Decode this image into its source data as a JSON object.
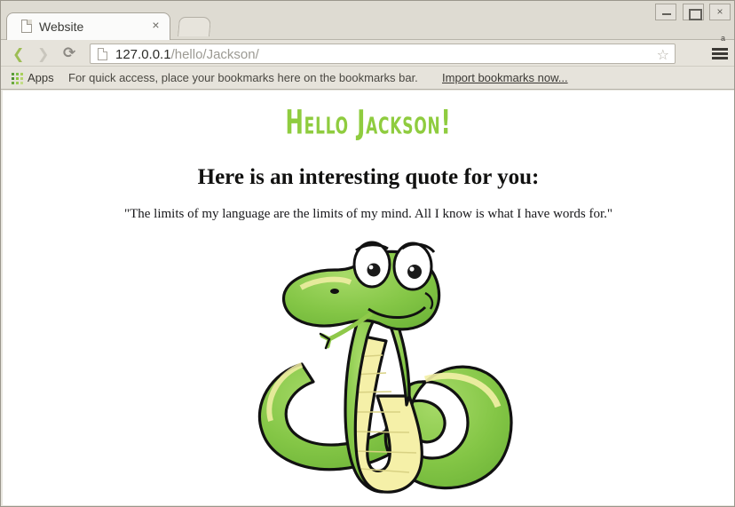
{
  "window": {
    "controls": {
      "minimize": "minimize-button",
      "maximize": "maximize-button",
      "close_label": "×"
    }
  },
  "tabs": [
    {
      "title": "Website",
      "favicon": "page-icon",
      "close_label": "×",
      "active": true
    }
  ],
  "newtab": {
    "label": ""
  },
  "toolbar": {
    "back_label": "❮",
    "forward_label": "❯",
    "reload_label": "⟳",
    "url_host": "127.0.0.1",
    "url_path": "/hello/Jackson/",
    "star_label": "☆",
    "menu_superscript": "a"
  },
  "bookmarks": {
    "apps_label": "Apps",
    "hint": "For quick access, place your bookmarks here on the bookmarks bar.",
    "import_label": "Import bookmarks now...",
    "apps_dot_colors": [
      "#5a9e3a",
      "#7cbf49",
      "#a8cf5a",
      "#4e8f33",
      "#8cc63f",
      "#b6d46d",
      "#6aa93e",
      "#9ccb53",
      "#c2dc86"
    ]
  },
  "page": {
    "greeting": "Hello Jackson!",
    "greeting_color": "#8fcc3f",
    "quote_heading": "Here is an interesting quote for you:",
    "quote_text": "\"The limits of my language are the limits of my mind.  All I know is what I have words for.\"",
    "image_alt": "cartoon-green-snake",
    "snake_colors": {
      "body": "#7dc242",
      "body_light": "#9ed45e",
      "belly": "#f5f0a8",
      "outline": "#111111",
      "eye_white": "#ffffff",
      "pupil": "#1a1a1a"
    }
  }
}
